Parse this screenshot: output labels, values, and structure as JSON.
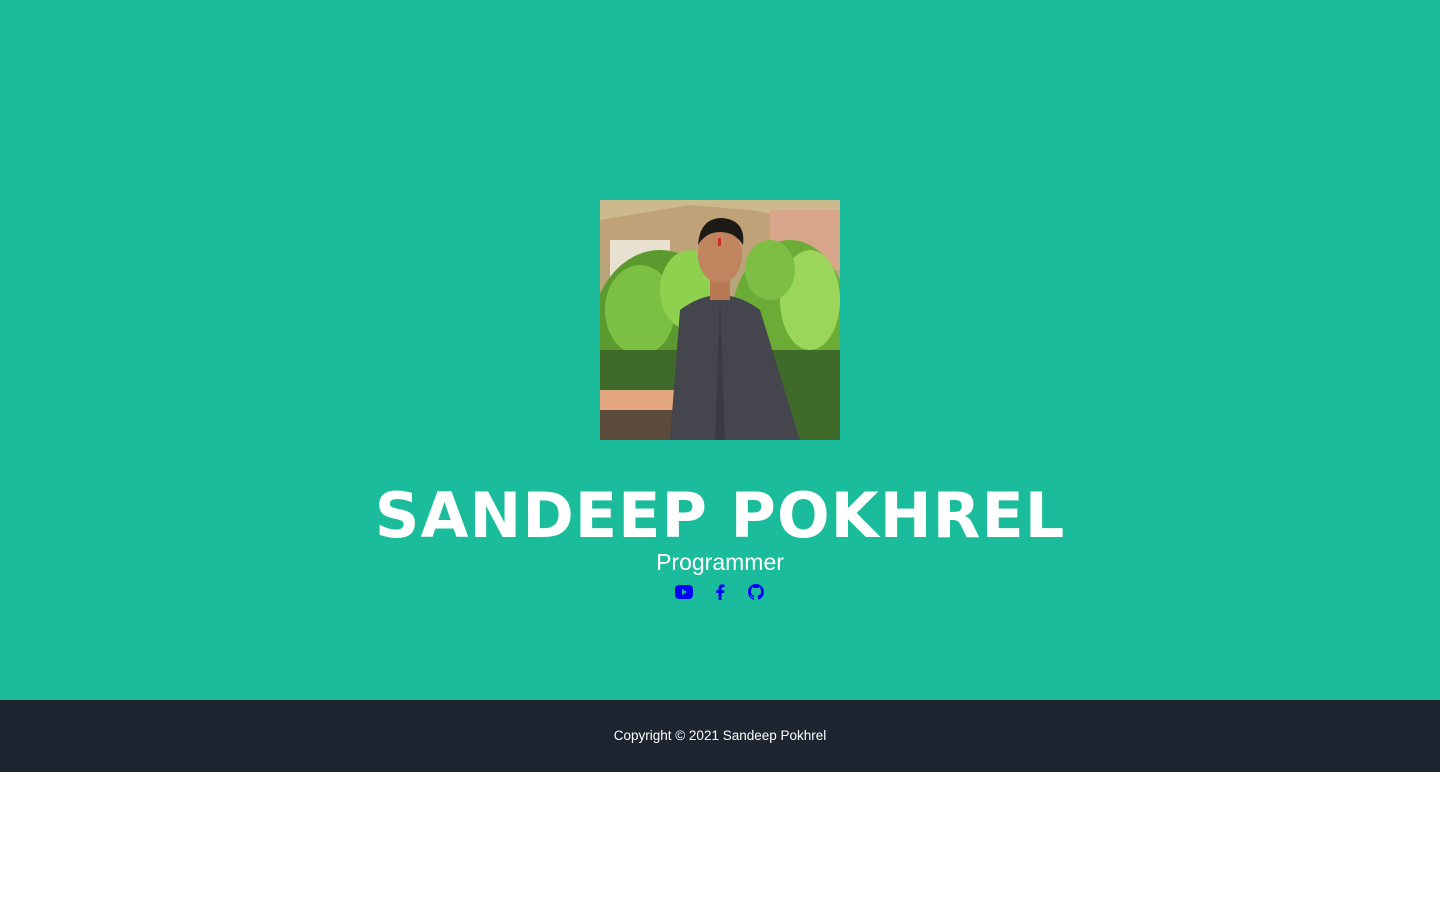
{
  "hero": {
    "name": "Sandeep Pokhrel",
    "role": "Programmer",
    "background_color": "#1abc9c"
  },
  "social": {
    "icon_color": "#0000ff",
    "links": [
      {
        "icon": "youtube-icon"
      },
      {
        "icon": "facebook-icon"
      },
      {
        "icon": "github-icon"
      }
    ]
  },
  "footer": {
    "text": "Copyright © 2021 Sandeep Pokhrel",
    "background_color": "#1e2530"
  }
}
